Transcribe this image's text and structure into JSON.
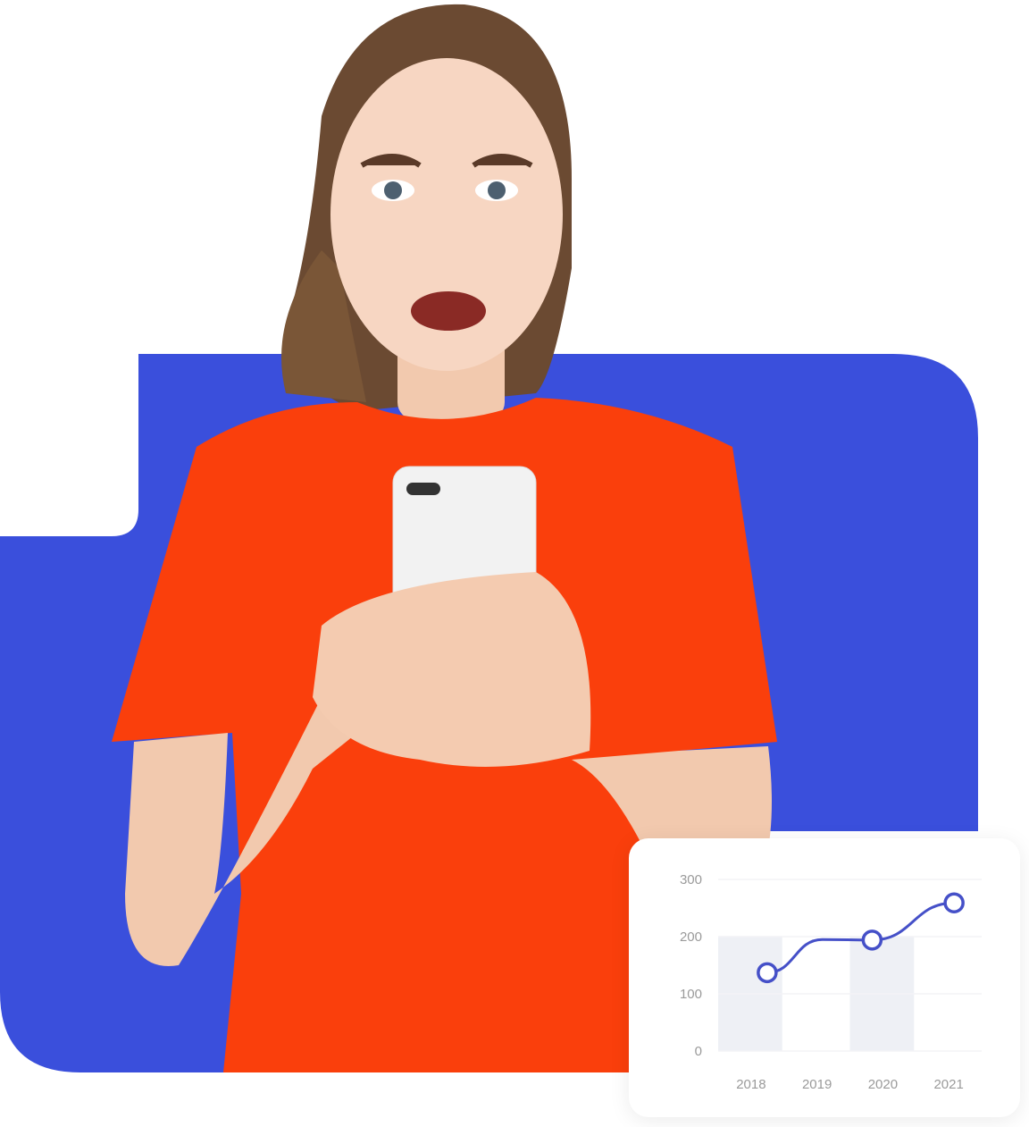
{
  "colors": {
    "background_shape": "#3a4fdc",
    "shirt": "#fa3f0c",
    "line": "#4550c8",
    "bar": "#eef0f5"
  },
  "scene": {
    "subject": "person-holding-phone"
  },
  "chart_data": {
    "type": "line",
    "categories": [
      "2018",
      "2019",
      "2020",
      "2021"
    ],
    "values": [
      137,
      195,
      194,
      259
    ],
    "markers": [
      true,
      false,
      true,
      true
    ],
    "highlighted_columns": [
      "2018",
      "2020"
    ],
    "yticks": [
      "0",
      "100",
      "200",
      "300"
    ],
    "ylim": [
      0,
      300
    ],
    "grid": true
  }
}
